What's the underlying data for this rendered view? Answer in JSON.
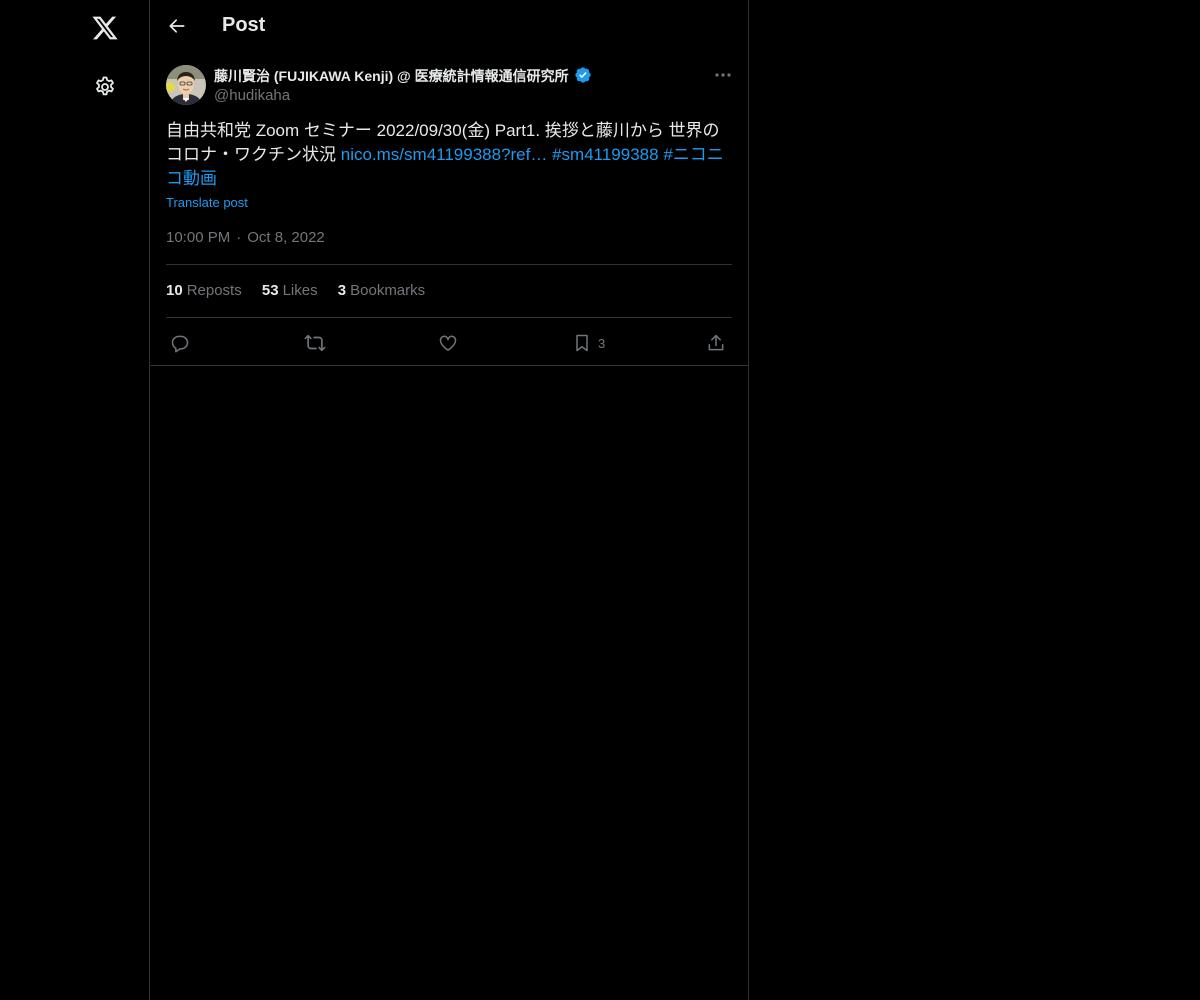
{
  "nav": {
    "logo_icon": "x-logo-icon",
    "settings_icon": "gear-icon"
  },
  "header": {
    "back_icon": "arrow-left-icon",
    "title": "Post"
  },
  "post": {
    "author": {
      "display_name": "藤川賢治 (FUJIKAWA Kenji) @ 医療統計情報通信研究所",
      "handle": "@hudikaha",
      "verified": true
    },
    "text_plain": "自由共和党 Zoom セミナー 2022/09/30(金) Part1. 挨拶と藤川から 世界のコロナ・ワクチン状況 ",
    "link": "nico.ms/sm41199388?ref…",
    "hashtag1": "#sm41199388",
    "hashtag2": "#ニコニコ動画",
    "translate_label": "Translate post",
    "time": "10:00 PM",
    "date": "Oct 8, 2022",
    "stats": {
      "reposts_count": "10",
      "reposts_label": "Reposts",
      "likes_count": "53",
      "likes_label": "Likes",
      "bookmarks_count": "3",
      "bookmarks_label": "Bookmarks"
    },
    "actions": {
      "bookmark_count": "3"
    }
  },
  "colors": {
    "background": "#000000",
    "text_primary": "#e7e9ea",
    "text_secondary": "#71767b",
    "accent": "#1d9bf0",
    "border": "#2f3336"
  }
}
